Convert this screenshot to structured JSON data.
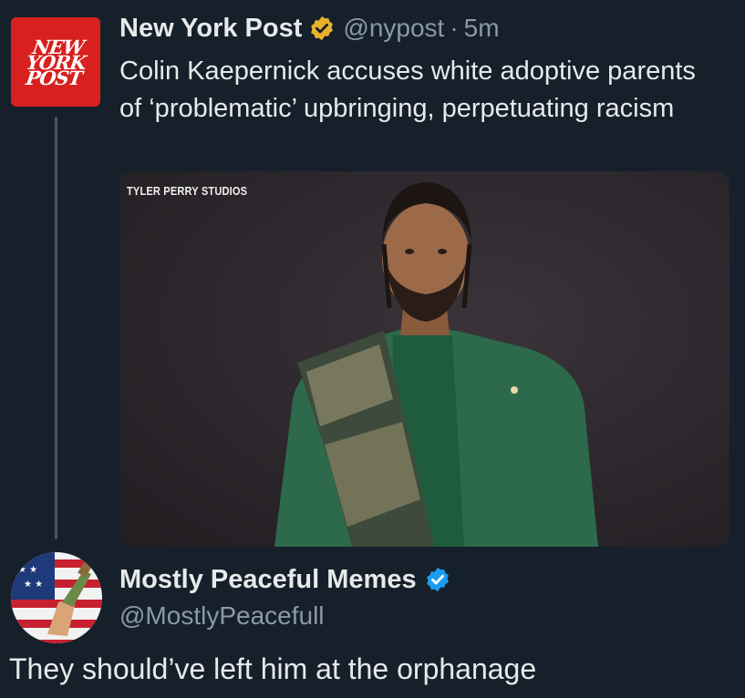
{
  "quoted_tweet": {
    "avatar_logo": [
      "NEW",
      "YORK",
      "POST"
    ],
    "author_name": "New York Post",
    "badge_icon": "gold-verified-badge-icon",
    "handle": "@nypost",
    "separator": "·",
    "time": "5m",
    "text": "Colin Kaepernick accuses white adoptive parents of ‘problematic’ upbringing, perpetuating racism",
    "photo": {
      "backdrop_text": "TYLER PERRY STUDIOS"
    }
  },
  "reply_tweet": {
    "avatar_icon": "american-flag-avatar-icon",
    "author_name": "Mostly Peaceful Memes",
    "badge_icon": "blue-verified-badge-icon",
    "handle": "@MostlyPeacefull",
    "text": "They should’ve left him at the orphanage"
  },
  "colors": {
    "background": "#15202b",
    "text": "#e7e9ea",
    "secondary_text": "#8b98a5",
    "nyp_red": "#d8201f",
    "gold_badge": "#e8b22d",
    "blue_badge": "#1d9bf0"
  }
}
